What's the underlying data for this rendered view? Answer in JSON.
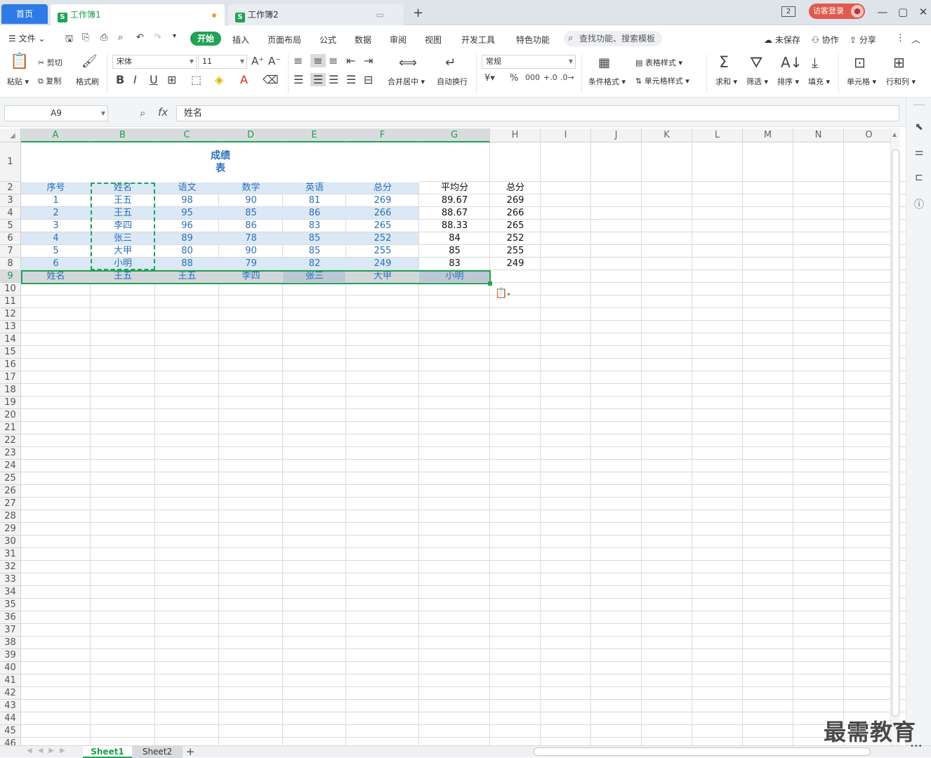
{
  "tabs": {
    "home": "首页",
    "docs": [
      {
        "label": "工作簿1",
        "icon": "S",
        "active": true
      },
      {
        "label": "工作簿2",
        "icon": "S",
        "active": false
      }
    ],
    "new_tab": "+",
    "window_count": "2",
    "login": "访客登录"
  },
  "menu": {
    "file": "文件",
    "items": [
      "开始",
      "插入",
      "页面布局",
      "公式",
      "数据",
      "审阅",
      "视图",
      "开发工具",
      "特色功能"
    ],
    "search_placeholder": "查找功能、搜索模板",
    "unsaved": "未保存",
    "collab": "协作",
    "share": "分享"
  },
  "ribbon": {
    "paste": "粘贴",
    "cut": "剪切",
    "copy": "复制",
    "format_painter": "格式刷",
    "font_name": "宋体",
    "font_size": "11",
    "merge_center": "合并居中",
    "wrap_text": "自动换行",
    "number_format": "常规",
    "conditional_format": "条件格式",
    "table_style": "表格样式",
    "cell_style": "单元格样式",
    "sum": "求和",
    "filter": "筛选",
    "sort": "排序",
    "fill": "填充",
    "cell": "单元格",
    "row_col": "行和列"
  },
  "formula_bar": {
    "name_box": "A9",
    "fx": "fx",
    "content": "姓名"
  },
  "columns": [
    "A",
    "B",
    "C",
    "D",
    "E",
    "F",
    "G",
    "H",
    "I",
    "J",
    "K",
    "L",
    "M",
    "N",
    "O"
  ],
  "sheet": {
    "title": "成绩\n表",
    "header": [
      "序号",
      "姓名",
      "语文",
      "数学",
      "英语",
      "总分",
      "平均分",
      "总分"
    ],
    "rows": [
      [
        "1",
        "王五",
        "98",
        "90",
        "81",
        "269",
        "89.67",
        "269"
      ],
      [
        "2",
        "王五",
        "95",
        "85",
        "86",
        "266",
        "88.67",
        "266"
      ],
      [
        "3",
        "李四",
        "96",
        "86",
        "83",
        "265",
        "88.33",
        "265"
      ],
      [
        "4",
        "张三",
        "89",
        "78",
        "85",
        "252",
        "84",
        "252"
      ],
      [
        "5",
        "大甲",
        "80",
        "90",
        "85",
        "255",
        "85",
        "255"
      ],
      [
        "6",
        "小明",
        "88",
        "79",
        "82",
        "249",
        "83",
        "249"
      ]
    ],
    "transposed_row": [
      "姓名",
      "王五",
      "王五",
      "李四",
      "张三",
      "大甲",
      "小明"
    ]
  },
  "sheet_tabs": [
    "Sheet1",
    "Sheet2"
  ],
  "watermark": "最需教育",
  "colors": {
    "accent": "#1fa354",
    "data_blue": "#2b70b8",
    "header_fill": "#dbe8f5",
    "brand_blue": "#2e7be6"
  }
}
